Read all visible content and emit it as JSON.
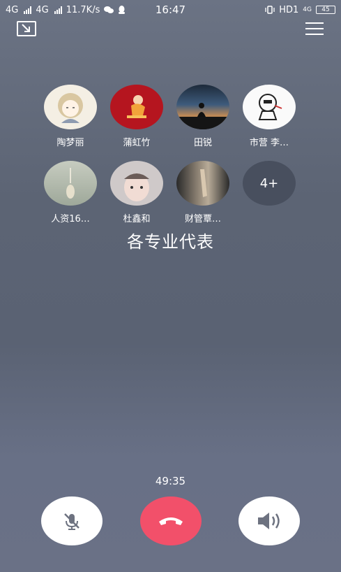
{
  "status_bar": {
    "net1": "4G",
    "net2": "4G",
    "speed": "11.7K/s",
    "time": "16:47",
    "hd": "HD1",
    "lte": "4G",
    "battery": "45"
  },
  "members": [
    {
      "name": "陶梦丽",
      "avatar": "cartoon-girl-avatar"
    },
    {
      "name": "蒲虹竹",
      "avatar": "red-character-avatar"
    },
    {
      "name": "田锐",
      "avatar": "sunset-silhouette-avatar"
    },
    {
      "name": "市营 李…",
      "avatar": "sketch-cartoon-avatar"
    },
    {
      "name": "人资16…",
      "avatar": "pale-figure-avatar"
    },
    {
      "name": "杜鑫和",
      "avatar": "baby-photo-avatar"
    },
    {
      "name": "财管覃…",
      "avatar": "hand-photo-avatar"
    }
  ],
  "more_label": "4+",
  "group_title": "各专业代表",
  "call_duration": "49:35",
  "colors": {
    "hangup": "#f2506a",
    "control_bg": "#ffffff"
  }
}
